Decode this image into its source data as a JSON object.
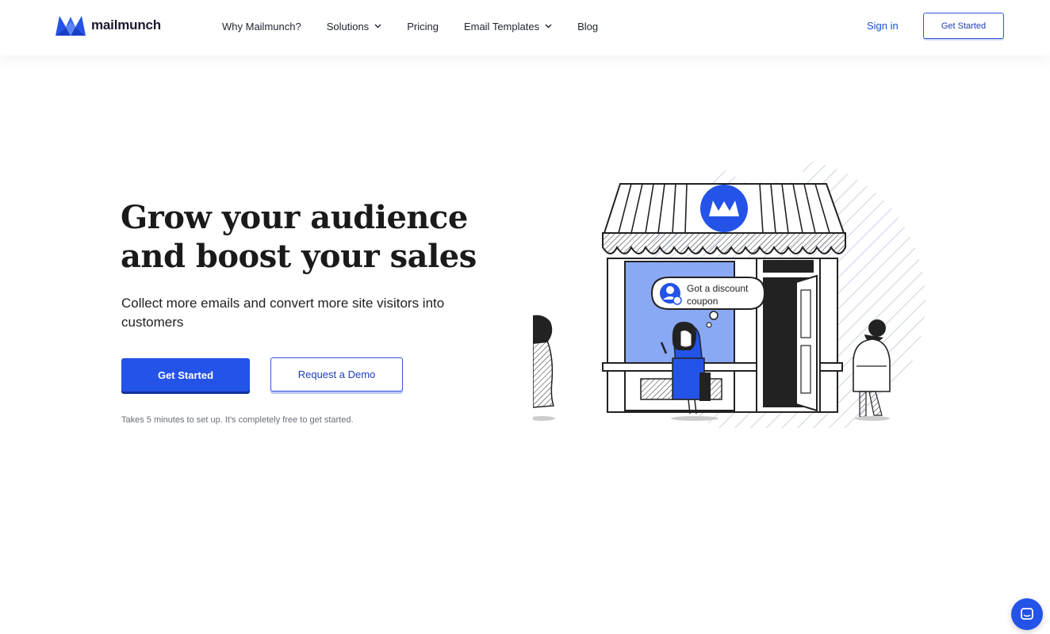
{
  "brand": {
    "name": "mailmunch",
    "primary_color": "#2453e8",
    "logo_icon": "mailmunch-logo-icon"
  },
  "header": {
    "nav": [
      {
        "label": "Why Mailmunch?",
        "has_dropdown": false
      },
      {
        "label": "Solutions",
        "has_dropdown": true
      },
      {
        "label": "Pricing",
        "has_dropdown": false
      },
      {
        "label": "Email Templates",
        "has_dropdown": true
      },
      {
        "label": "Blog",
        "has_dropdown": false
      }
    ],
    "sign_in": "Sign in",
    "cta": "Get Started"
  },
  "hero": {
    "title_line1": "Grow your audience",
    "title_line2": "and boost your sales",
    "subtitle": "Collect more emails and convert more site visitors into customers",
    "primary_button": "Get Started",
    "secondary_button": "Request a Demo",
    "note": "Takes 5 minutes to set up. It's completely free to get started."
  },
  "illustration": {
    "speech_bubble_line1": "Got a discount",
    "speech_bubble_line2": "coupon"
  },
  "chat_widget": {
    "icon": "chat-icon"
  }
}
